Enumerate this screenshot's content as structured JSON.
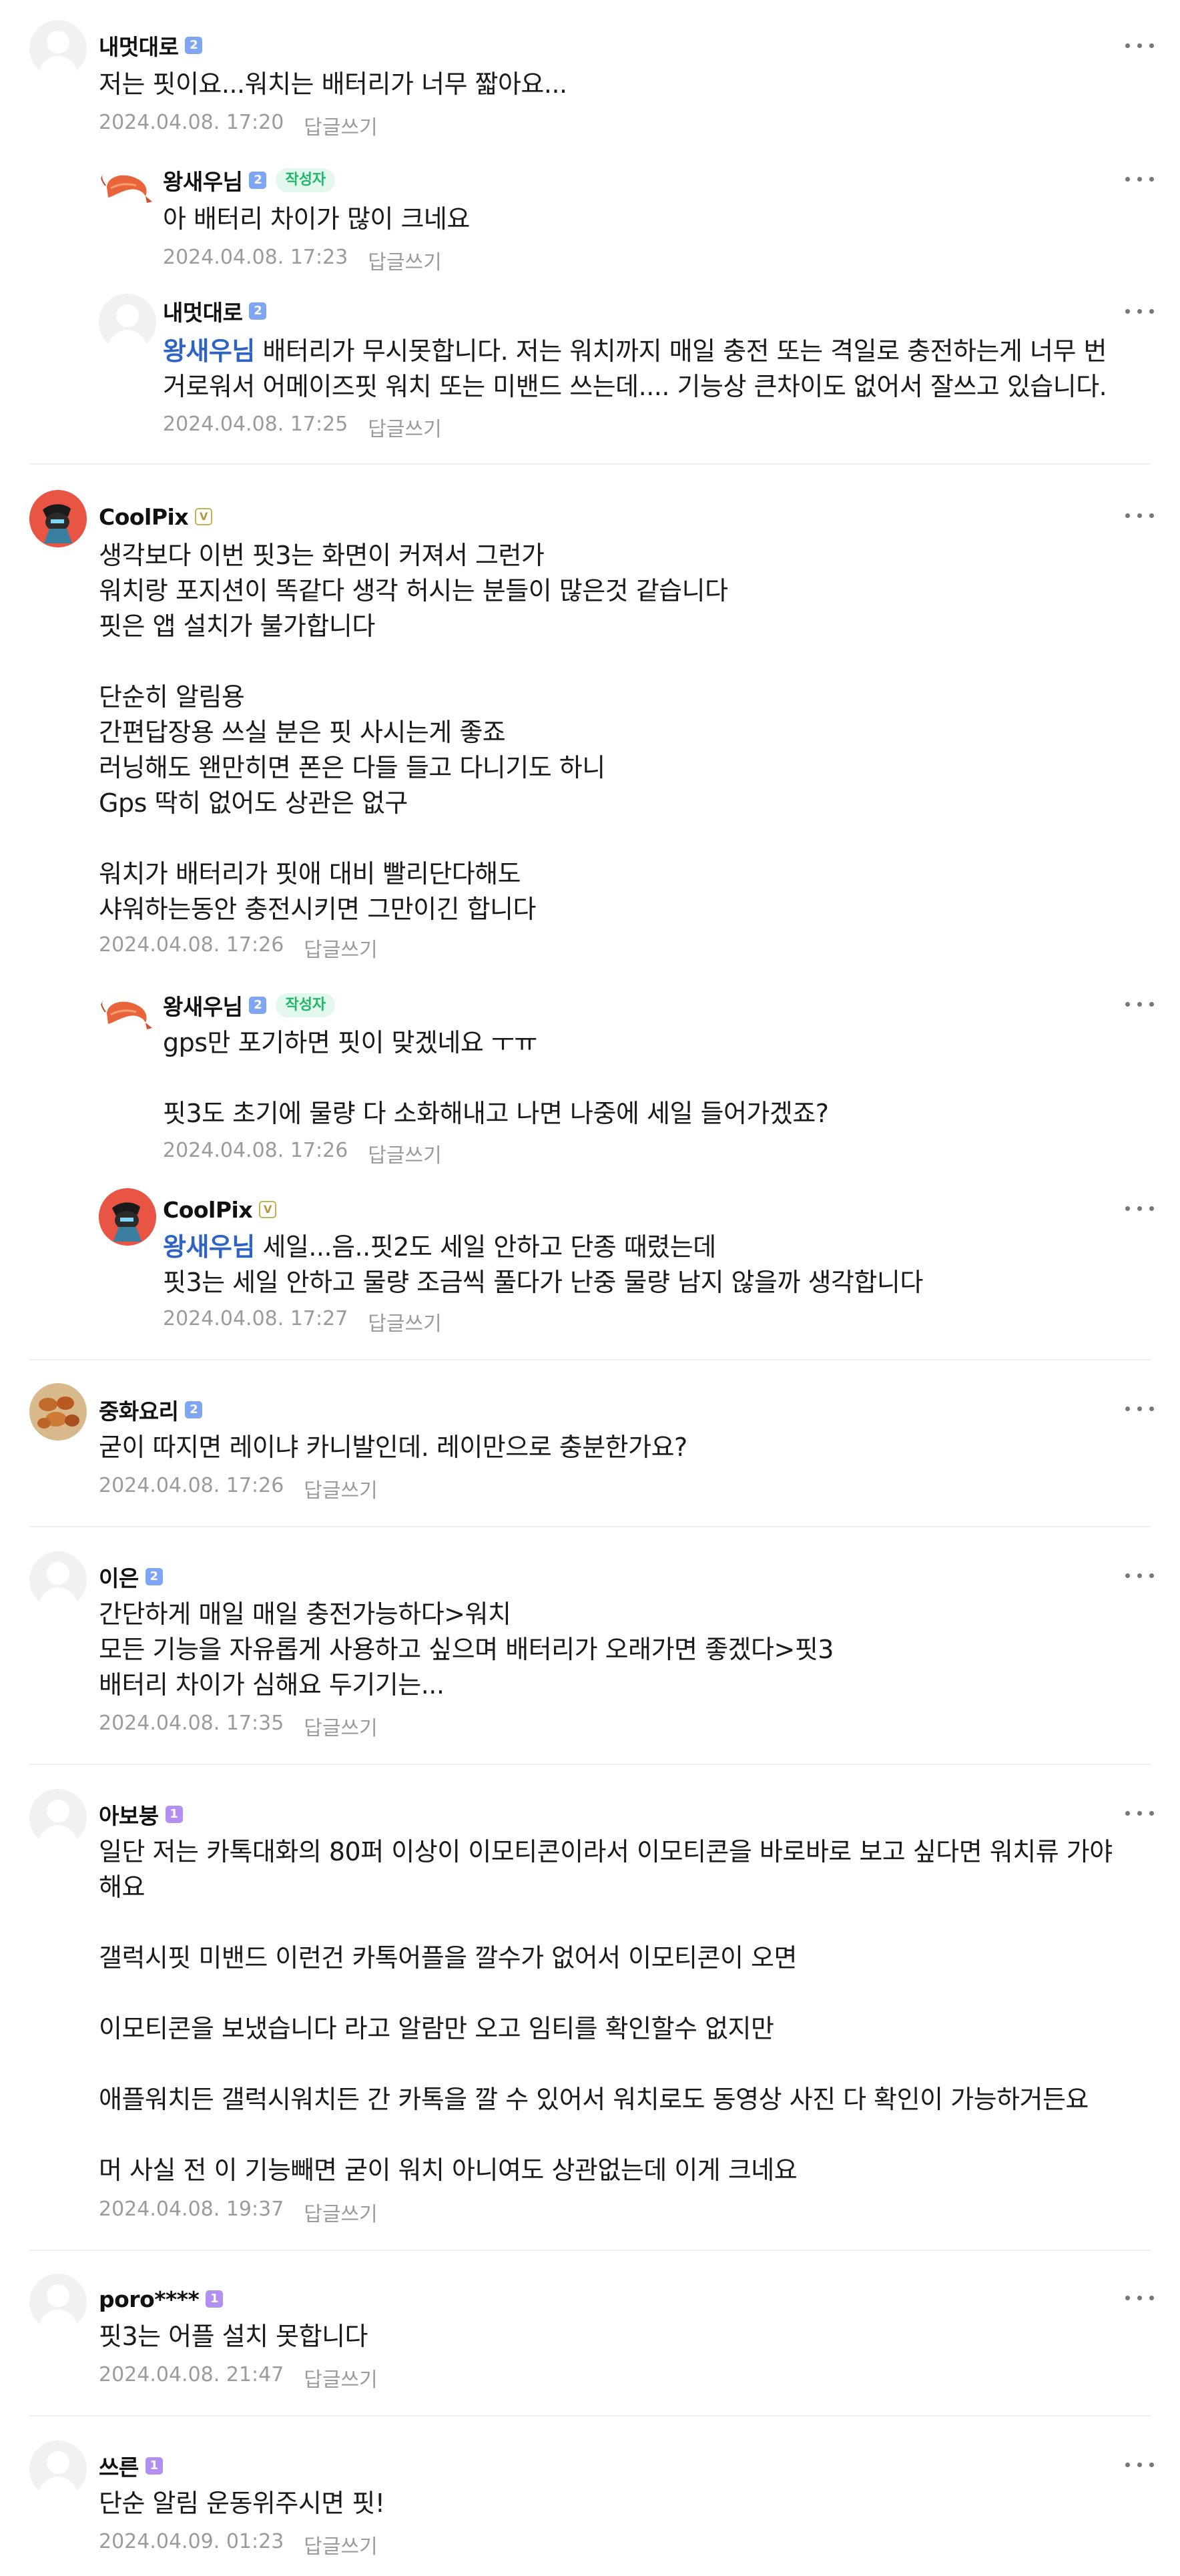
{
  "comments": [
    {
      "nickname": "내멋대로",
      "level": "2",
      "text": "저는 핏이요...워치는 배터리가 너무 짧아요...",
      "date": "2024.04.08. 17:20",
      "reply_label": "답글쓰기",
      "replies": [
        {
          "nickname": "왕새우님",
          "level": "2",
          "author_badge": "작성자",
          "text": "아 배터리 차이가 많이 크네요",
          "date": "2024.04.08. 17:23",
          "reply_label": "답글쓰기"
        },
        {
          "nickname": "내멋대로",
          "level": "2",
          "mention": "왕새우님",
          "text": " 배터리가 무시못합니다. 저는 워치까지 매일 충전 또는 격일로 충전하는게 너무 번\n거로워서 어메이즈핏 워치 또는 미밴드 쓰는데.... 기능상 큰차이도 없어서 잘쓰고 있습니다.",
          "date": "2024.04.08. 17:25",
          "reply_label": "답글쓰기"
        }
      ]
    },
    {
      "nickname": "CoolPix",
      "level": "V",
      "text": "생각보다 이번 핏3는 화면이 커져서 그런가\n워치랑 포지션이 똑같다 생각 허시는 분들이 많은것 같습니다\n핏은 앱 설치가 불가합니다\n\n단순히 알림용\n간편답장용 쓰실 분은 핏 사시는게 좋죠\n러닝해도 왠만히면 폰은 다들 들고 다니기도 하니\nGps 딱히 없어도 상관은 없구\n\n워치가 배터리가 핏애 대비 빨리단다해도\n샤워하는동안 충전시키면 그만이긴 합니다",
      "date": "2024.04.08. 17:26",
      "reply_label": "답글쓰기",
      "replies": [
        {
          "nickname": "왕새우님",
          "level": "2",
          "author_badge": "작성자",
          "text": "gps만 포기하면 핏이 맞겠네요 ㅜㅠ\n\n핏3도 초기에 물량 다 소화해내고 나면 나중에 세일 들어가겠죠?",
          "date": "2024.04.08. 17:26",
          "reply_label": "답글쓰기"
        },
        {
          "nickname": "CoolPix",
          "level": "V",
          "mention": "왕새우님",
          "text": " 세일...음..핏2도 세일 안하고 단종 때렸는데\n핏3는 세일 안하고 물량 조금씩 풀다가 난중 물량 남지 않을까 생각합니다",
          "date": "2024.04.08. 17:27",
          "reply_label": "답글쓰기"
        }
      ]
    },
    {
      "nickname": "중화요리",
      "level": "2",
      "text": "굳이 따지면 레이냐 카니발인데. 레이만으로 충분한가요?",
      "date": "2024.04.08. 17:26",
      "reply_label": "답글쓰기"
    },
    {
      "nickname": "이은",
      "level": "2",
      "text": "간단하게 매일 매일 충전가능하다>워치\n모든 기능을 자유롭게 사용하고 싶으며 배터리가 오래가면 좋겠다>핏3\n배터리 차이가 심해요 두기기는...",
      "date": "2024.04.08. 17:35",
      "reply_label": "답글쓰기"
    },
    {
      "nickname": "아보붕",
      "level": "1",
      "text": "일단 저는 카톡대화의 80퍼 이상이 이모티콘이라서 이모티콘을 바로바로 보고 싶다면 워치류 가야\n해요\n\n갤럭시핏 미밴드 이런건 카톡어플을 깔수가 없어서 이모티콘이 오면\n\n이모티콘을 보냈습니다 라고 알람만 오고 임티를 확인할수 없지만\n\n애플워치든 갤럭시워치든 간 카톡을 깔 수 있어서 워치로도 동영상 사진 다 확인이 가능하거든요\n\n머 사실 전 이 기능빼면 굳이 워치 아니여도 상관없는데 이게 크네요",
      "date": "2024.04.08. 19:37",
      "reply_label": "답글쓰기"
    },
    {
      "nickname": "poro****",
      "level": "1",
      "text": "핏3는 어플 설치 못합니다",
      "date": "2024.04.08. 21:47",
      "reply_label": "답글쓰기"
    },
    {
      "nickname": "쓰른",
      "level": "1",
      "text": "단순 알림 운동위주시면 핏!",
      "date": "2024.04.09. 01:23",
      "reply_label": "답글쓰기"
    }
  ]
}
